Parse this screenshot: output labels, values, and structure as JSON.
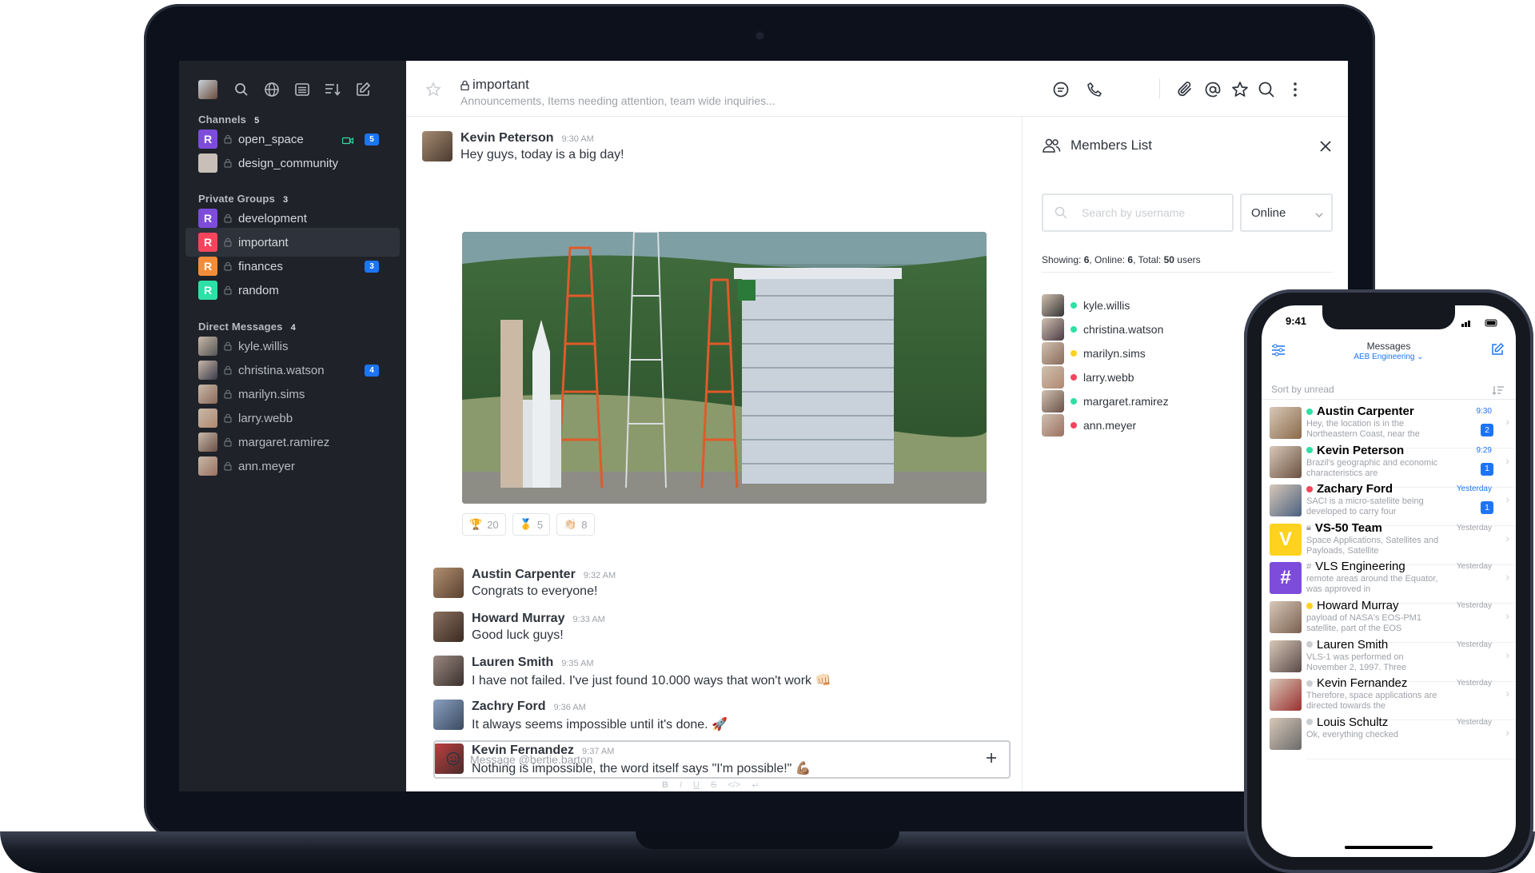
{
  "sidebar": {
    "channels_label": "Channels",
    "channels_count": "5",
    "channels": [
      {
        "name": "open_space",
        "avatar": "R",
        "color": "#7d4cdb",
        "badge": "5"
      },
      {
        "name": "design_community",
        "avatar": "",
        "color": "#c8c0b8",
        "badge": ""
      }
    ],
    "groups_label": "Private Groups",
    "groups_count": "3",
    "groups": [
      {
        "name": "development",
        "avatar": "R",
        "color": "#7d4cdb",
        "badge": ""
      },
      {
        "name": "important",
        "avatar": "R",
        "color": "#f5455c",
        "badge": ""
      },
      {
        "name": "finances",
        "avatar": "R",
        "color": "#f38c39",
        "badge": "3"
      },
      {
        "name": "random",
        "avatar": "R",
        "color": "#2de0a5",
        "badge": ""
      }
    ],
    "dm_label": "Direct Messages",
    "dm_count": "4",
    "dms": [
      {
        "name": "kyle.willis",
        "badge": ""
      },
      {
        "name": "christina.watson",
        "badge": "4"
      },
      {
        "name": "marilyn.sims",
        "badge": ""
      },
      {
        "name": "larry.webb",
        "badge": ""
      },
      {
        "name": "margaret.ramirez",
        "badge": ""
      },
      {
        "name": "ann.meyer",
        "badge": ""
      }
    ]
  },
  "header": {
    "room": "important",
    "topic": "Announcements, Items needing attention, team wide inquiries..."
  },
  "messages": [
    {
      "author": "Kevin Peterson",
      "time": "9:30 AM",
      "text": "Hey guys, today is a big day!"
    },
    {
      "author": "Austin Carpenter",
      "time": "9:32 AM",
      "text": "Congrats to everyone!"
    },
    {
      "author": "Howard Murray",
      "time": "9:33 AM",
      "text": "Good luck guys!"
    },
    {
      "author": "Lauren Smith",
      "time": "9:35 AM",
      "text": "I have not failed. I've just found 10.000 ways that won't work 👊🏻"
    },
    {
      "author": "Zachry Ford",
      "time": "9:36 AM",
      "text": "It always seems impossible until it's done. 🚀"
    },
    {
      "author": "Kevin Fernandez",
      "time": "9:37 AM",
      "text": "Nothing is impossible, the word itself says \"I'm possible!\" 💪🏽"
    }
  ],
  "reactions": [
    {
      "emoji": "🏆",
      "count": "20"
    },
    {
      "emoji": "🥇",
      "count": "5"
    },
    {
      "emoji": "👏🏻",
      "count": "8"
    }
  ],
  "composer": {
    "placeholder": "Message @bertie.barton",
    "format_buttons": [
      "B",
      "I",
      "U",
      "S",
      "</>",
      "↵"
    ]
  },
  "members_panel": {
    "title": "Members List",
    "search_placeholder": "Search by username",
    "filter": "Online",
    "showing_label": "Showing: ",
    "showing": "6",
    "online_label": ", Online: ",
    "online": "6",
    "total_label": ", Total: ",
    "total": "50",
    "users_label": " users",
    "members": [
      {
        "name": "kyle.willis",
        "status": "#2de0a5"
      },
      {
        "name": "christina.watson",
        "status": "#2de0a5"
      },
      {
        "name": "marilyn.sims",
        "status": "#ffd21f"
      },
      {
        "name": "larry.webb",
        "status": "#f5455c"
      },
      {
        "name": "margaret.ramirez",
        "status": "#2de0a5"
      },
      {
        "name": "ann.meyer",
        "status": "#f5455c"
      }
    ]
  },
  "phone": {
    "time": "9:41",
    "title": "Messages",
    "team": "AEB Engineering",
    "sort": "Sort by unread",
    "rows": [
      {
        "name": "Austin Carpenter",
        "preview": "Hey, the location is in the Northeastern Coast, near the",
        "ts": "9:30",
        "badge": "2",
        "dot": "#2de0a5",
        "bold": true,
        "avatar": "",
        "color": "#8a6a4a"
      },
      {
        "name": "Kevin Peterson",
        "preview": "Brazil's geographic and economic characteristics are",
        "ts": "9:29",
        "badge": "1",
        "dot": "#2de0a5",
        "bold": true,
        "avatar": "",
        "color": "#6b5040"
      },
      {
        "name": "Zachary Ford",
        "preview": "SACI is a micro-satellite being developed to carry four",
        "ts": "Yesterday",
        "badge": "1",
        "dot": "#f5455c",
        "bold": true,
        "avatar": "",
        "color": "#4a6080"
      },
      {
        "name": "VS-50 Team",
        "preview": "Space Applications, Satellites and Payloads, Satellite",
        "ts": "Yesterday",
        "badge": "",
        "dot": "",
        "bold": true,
        "avatar": "V",
        "color": "#ffd21f"
      },
      {
        "name": "VLS Engineering",
        "preview": "remote areas around the Equator, was approved in",
        "ts": "Yesterday",
        "badge": "",
        "dot": "",
        "bold": false,
        "avatar": "#",
        "color": "#7d4cdb"
      },
      {
        "name": "Howard Murray",
        "preview": "payload of NASA's EOS-PM1 satellite, part of the EOS",
        "ts": "Yesterday",
        "badge": "",
        "dot": "#ffd21f",
        "bold": false,
        "avatar": "",
        "color": "#7a6050"
      },
      {
        "name": "Lauren Smith",
        "preview": "VLS-1 was performed on November 2, 1997. Three",
        "ts": "Yesterday",
        "badge": "",
        "dot": "#cbced1",
        "bold": false,
        "avatar": "",
        "color": "#5a4a48"
      },
      {
        "name": "Kevin Fernandez",
        "preview": "Therefore, space applications are directed towards the",
        "ts": "Yesterday",
        "badge": "",
        "dot": "#cbced1",
        "bold": false,
        "avatar": "",
        "color": "#9a3030"
      },
      {
        "name": "Louis Schultz",
        "preview": "Ok, everything checked",
        "ts": "Yesterday",
        "badge": "",
        "dot": "#cbced1",
        "bold": false,
        "avatar": "",
        "color": "#6a6a6a"
      }
    ]
  }
}
